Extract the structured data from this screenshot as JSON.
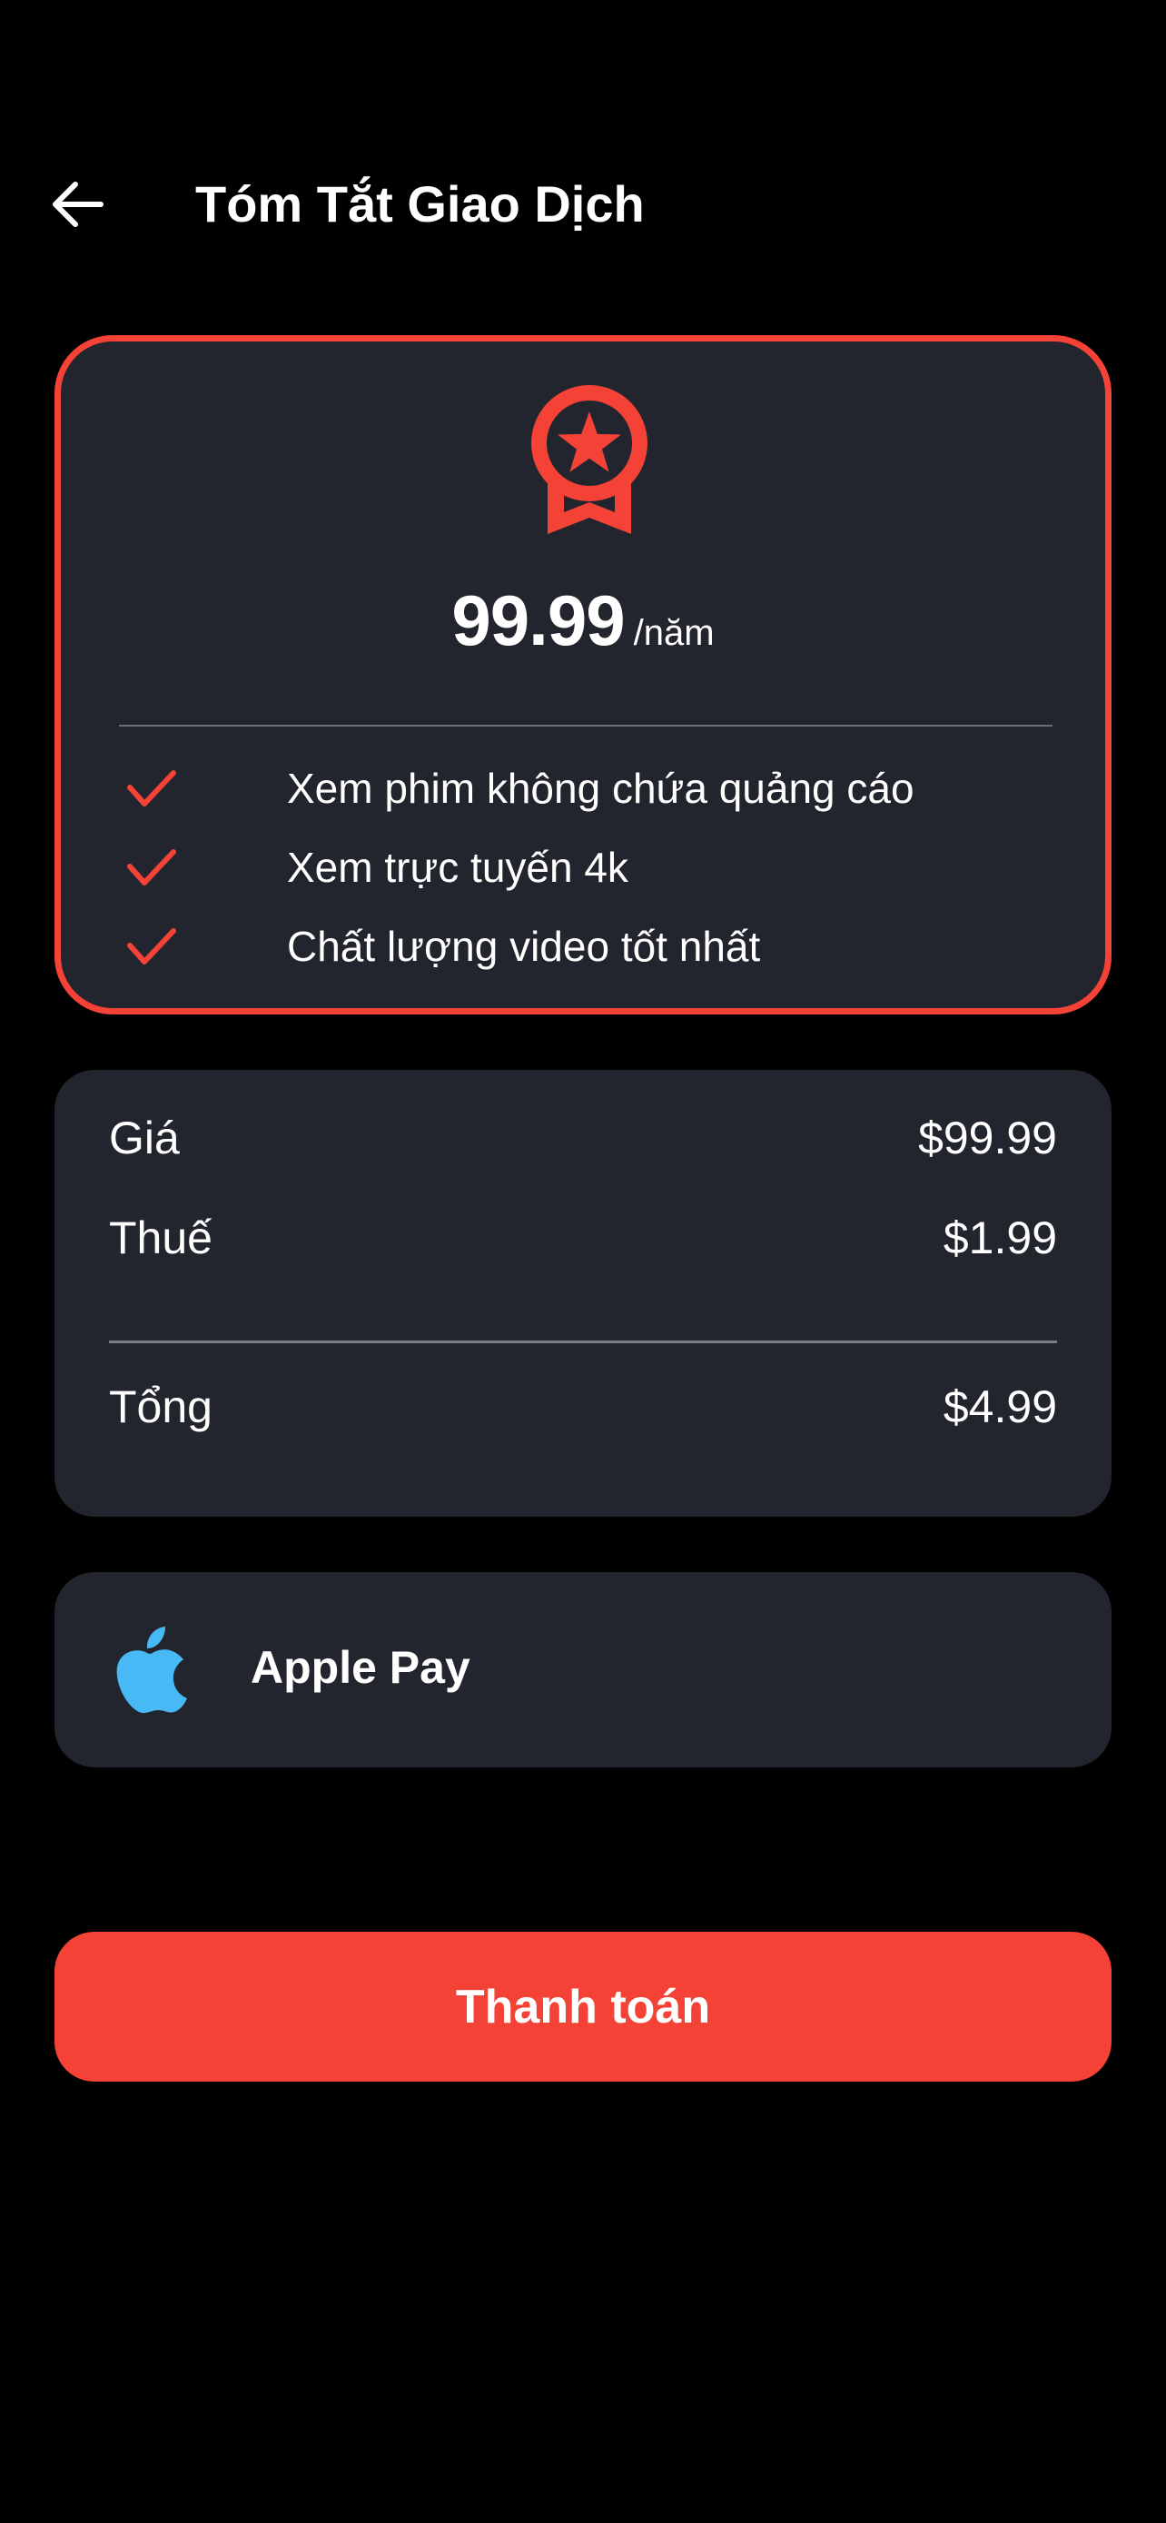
{
  "colors": {
    "background": "#000000",
    "card": "#22252d",
    "accent": "#f44336",
    "apple_blue": "#47b9f5",
    "text": "#ffffff",
    "divider": "#6c6f76"
  },
  "header": {
    "back_icon": "arrow-left-icon",
    "title": "Tóm Tắt Giao Dịch"
  },
  "plan": {
    "icon": "medal-star-icon",
    "price": "99.99",
    "period": "/năm",
    "features": [
      {
        "icon": "check-icon",
        "text": "Xem phim không chứa quảng cáo"
      },
      {
        "icon": "check-icon",
        "text": "Xem trực tuyến 4k"
      },
      {
        "icon": "check-icon",
        "text": "Chất lượng video tốt nhất"
      }
    ]
  },
  "summary": {
    "price_label": "Giá",
    "price_value": "$99.99",
    "tax_label": "Thuế",
    "tax_value": "$1.99",
    "total_label": "Tổng",
    "total_value": "$4.99"
  },
  "payment": {
    "icon": "apple-icon",
    "method": "Apple Pay"
  },
  "actions": {
    "pay_label": "Thanh toán"
  }
}
